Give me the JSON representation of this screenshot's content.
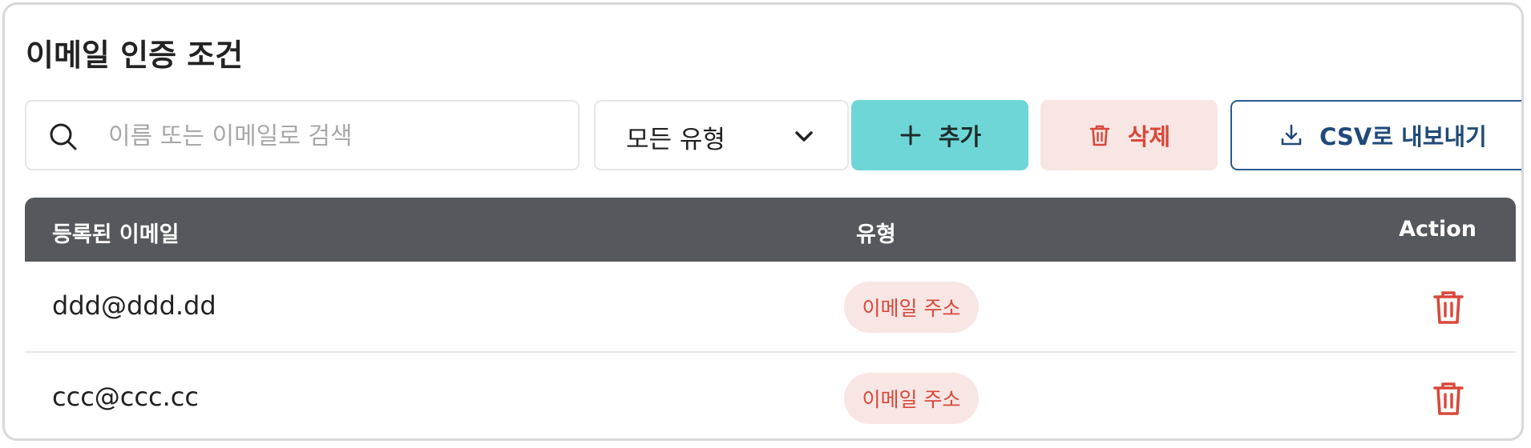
{
  "page": {
    "title": "이메일 인증 조건"
  },
  "toolbar": {
    "search_placeholder": "이름 또는 이메일로 검색",
    "search_value": "",
    "type_filter_value": "모든 유형",
    "add_label": "추가",
    "delete_label": "삭제",
    "export_label": "CSV로 내보내기"
  },
  "table": {
    "headers": {
      "email": "등록된 이메일",
      "type": "유형",
      "action": "Action"
    },
    "rows": [
      {
        "email": "ddd@ddd.dd",
        "type": "이메일 주소"
      },
      {
        "email": "ccc@ccc.cc",
        "type": "이메일 주소"
      }
    ]
  },
  "colors": {
    "add_button_bg": "#6ed6d6",
    "delete_button_bg": "#f8e6e4",
    "delete_accent": "#d8483a",
    "export_border": "#2b5a8e",
    "table_header_bg": "#55585c"
  },
  "icons": {
    "search": "search-icon",
    "type_dropdown": "chevron-down-icon",
    "add": "plus-icon",
    "delete": "trash-icon",
    "export": "download-icon",
    "row_action": "trash-icon"
  }
}
